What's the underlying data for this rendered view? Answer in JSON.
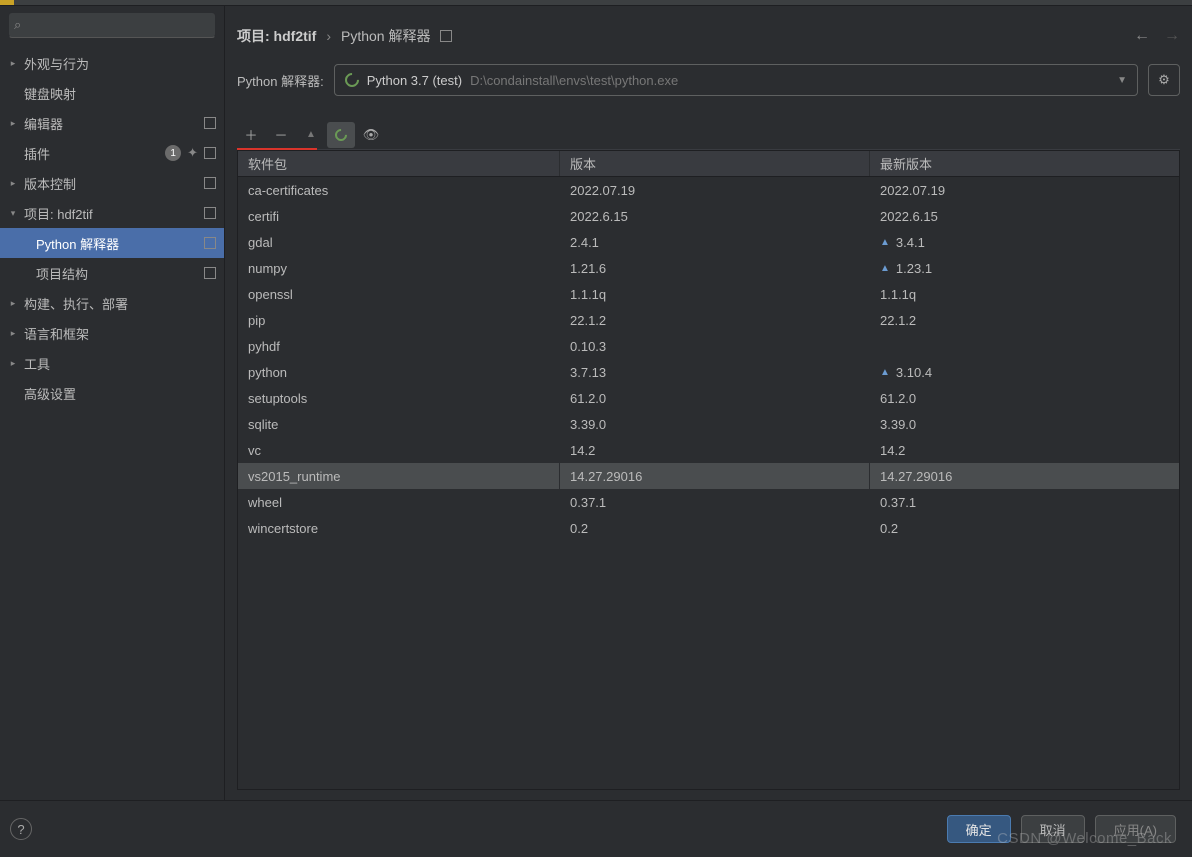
{
  "search": {
    "placeholder": ""
  },
  "sidebar": {
    "items": [
      {
        "label": "外观与行为",
        "expandable": true
      },
      {
        "label": "键盘映射",
        "expandable": false
      },
      {
        "label": "编辑器",
        "expandable": true,
        "hasSquare": true
      },
      {
        "label": "插件",
        "expandable": false,
        "badge": "1",
        "hasI18n": true,
        "hasSquare": true
      },
      {
        "label": "版本控制",
        "expandable": true,
        "hasSquare": true
      },
      {
        "label": "项目: hdf2tif",
        "expandable": true,
        "open": true,
        "hasSquare": true,
        "children": [
          {
            "label": "Python 解释器",
            "selected": true,
            "hasSquare": true
          },
          {
            "label": "项目结构",
            "hasSquare": true
          }
        ]
      },
      {
        "label": "构建、执行、部署",
        "expandable": true
      },
      {
        "label": "语言和框架",
        "expandable": true
      },
      {
        "label": "工具",
        "expandable": true
      },
      {
        "label": "高级设置",
        "expandable": false
      }
    ]
  },
  "breadcrumb": {
    "root": "项目: hdf2tif",
    "sep": "›",
    "current": "Python 解释器"
  },
  "interpreter": {
    "label": "Python 解释器:",
    "name": "Python 3.7 (test)",
    "path": "D:\\condainstall\\envs\\test\\python.exe"
  },
  "columns": {
    "name": "软件包",
    "version": "版本",
    "latest": "最新版本"
  },
  "packages": [
    {
      "name": "ca-certificates",
      "version": "2022.07.19",
      "latest": "2022.07.19"
    },
    {
      "name": "certifi",
      "version": "2022.6.15",
      "latest": "2022.6.15"
    },
    {
      "name": "gdal",
      "version": "2.4.1",
      "latest": "3.4.1",
      "upgrade": true
    },
    {
      "name": "numpy",
      "version": "1.21.6",
      "latest": "1.23.1",
      "upgrade": true
    },
    {
      "name": "openssl",
      "version": "1.1.1q",
      "latest": "1.1.1q"
    },
    {
      "name": "pip",
      "version": "22.1.2",
      "latest": "22.1.2"
    },
    {
      "name": "pyhdf",
      "version": "0.10.3",
      "latest": ""
    },
    {
      "name": "python",
      "version": "3.7.13",
      "latest": "3.10.4",
      "upgrade": true
    },
    {
      "name": "setuptools",
      "version": "61.2.0",
      "latest": "61.2.0"
    },
    {
      "name": "sqlite",
      "version": "3.39.0",
      "latest": "3.39.0"
    },
    {
      "name": "vc",
      "version": "14.2",
      "latest": "14.2"
    },
    {
      "name": "vs2015_runtime",
      "version": "14.27.29016",
      "latest": "14.27.29016",
      "selected": true
    },
    {
      "name": "wheel",
      "version": "0.37.1",
      "latest": "0.37.1"
    },
    {
      "name": "wincertstore",
      "version": "0.2",
      "latest": "0.2"
    }
  ],
  "buttons": {
    "ok": "确定",
    "cancel": "取消",
    "apply": "应用(A)"
  },
  "watermark": "CSDN @Welcome_Back"
}
